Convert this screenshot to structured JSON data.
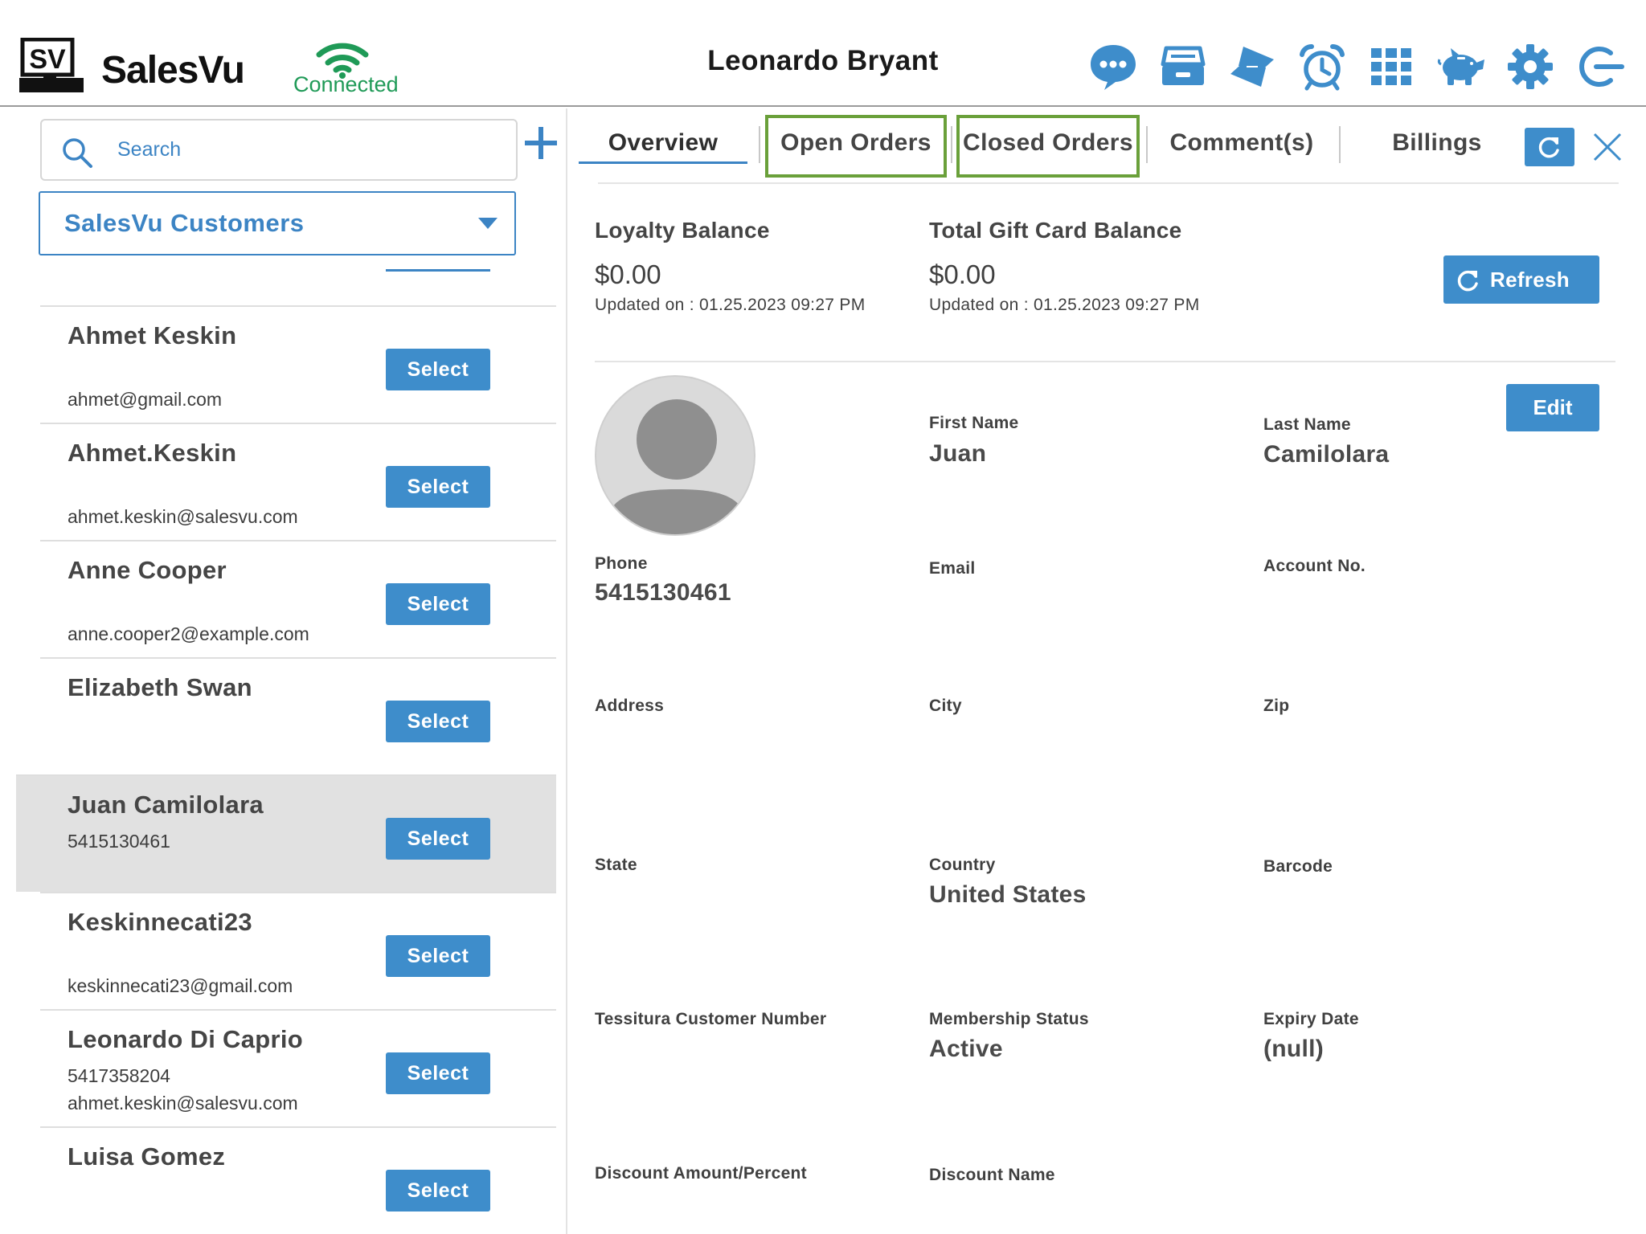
{
  "header": {
    "logo_text": "SV",
    "app_name": "SalesVu",
    "connection_status": "Connected",
    "user_name": "Leonardo Bryant",
    "icons": [
      "chat-icon",
      "cash-drawer-icon",
      "transfer-icon",
      "alarm-clock-icon",
      "grid-icon",
      "piggy-bank-icon",
      "gear-icon",
      "logout-icon"
    ]
  },
  "sidebar": {
    "search_placeholder": "Search",
    "group": "SalesVu Customers",
    "customers": [
      {
        "name": "Ahmet Keskin",
        "line1": "",
        "line2": "ahmet@gmail.com",
        "select": "Select"
      },
      {
        "name": "Ahmet.Keskin",
        "line1": "",
        "line2": "ahmet.keskin@salesvu.com",
        "select": "Select"
      },
      {
        "name": "Anne Cooper",
        "line1": "",
        "line2": "anne.cooper2@example.com",
        "select": "Select"
      },
      {
        "name": "Elizabeth Swan",
        "line1": "",
        "line2": "",
        "select": "Select"
      },
      {
        "name": "Juan Camilolara",
        "line1": "5415130461",
        "line2": "",
        "select": "Select"
      },
      {
        "name": "Keskinnecati23",
        "line1": "",
        "line2": "keskinnecati23@gmail.com",
        "select": "Select"
      },
      {
        "name": "Leonardo Di Caprio",
        "line1": "5417358204",
        "line2": "ahmet.keskin@salesvu.com",
        "select": "Select"
      },
      {
        "name": "Luisa Gomez",
        "line1": "",
        "line2": "",
        "select": "Select"
      }
    ]
  },
  "tabs": [
    "Overview",
    "Open Orders",
    "Closed Orders",
    "Comment(s)",
    "Billings"
  ],
  "balances": {
    "loyalty_label": "Loyalty Balance",
    "loyalty_value": "$0.00",
    "loyalty_updated": "Updated on :  01.25.2023 09:27 PM",
    "gift_label": "Total Gift Card Balance",
    "gift_value": "$0.00",
    "gift_updated": "Updated on :  01.25.2023 09:27 PM",
    "refresh_label": "Refresh"
  },
  "profile": {
    "edit_label": "Edit",
    "first_name_label": "First Name",
    "first_name": "Juan",
    "last_name_label": "Last Name",
    "last_name": "Camilolara",
    "phone_label": "Phone",
    "phone": "5415130461",
    "email_label": "Email",
    "account_label": "Account No.",
    "address_label": "Address",
    "city_label": "City",
    "zip_label": "Zip",
    "state_label": "State",
    "country_label": "Country",
    "country": "United States",
    "barcode_label": "Barcode",
    "tessitura_label": "Tessitura Customer Number",
    "membership_label": "Membership Status",
    "membership": "Active",
    "expiry_label": "Expiry Date",
    "expiry": "(null)",
    "discount_amount_label": "Discount Amount/Percent",
    "discount_name_label": "Discount Name"
  },
  "colors": {
    "accent": "#3e8dcb",
    "connected": "#1f9a57",
    "tab_highlight": "#6aa03a"
  }
}
